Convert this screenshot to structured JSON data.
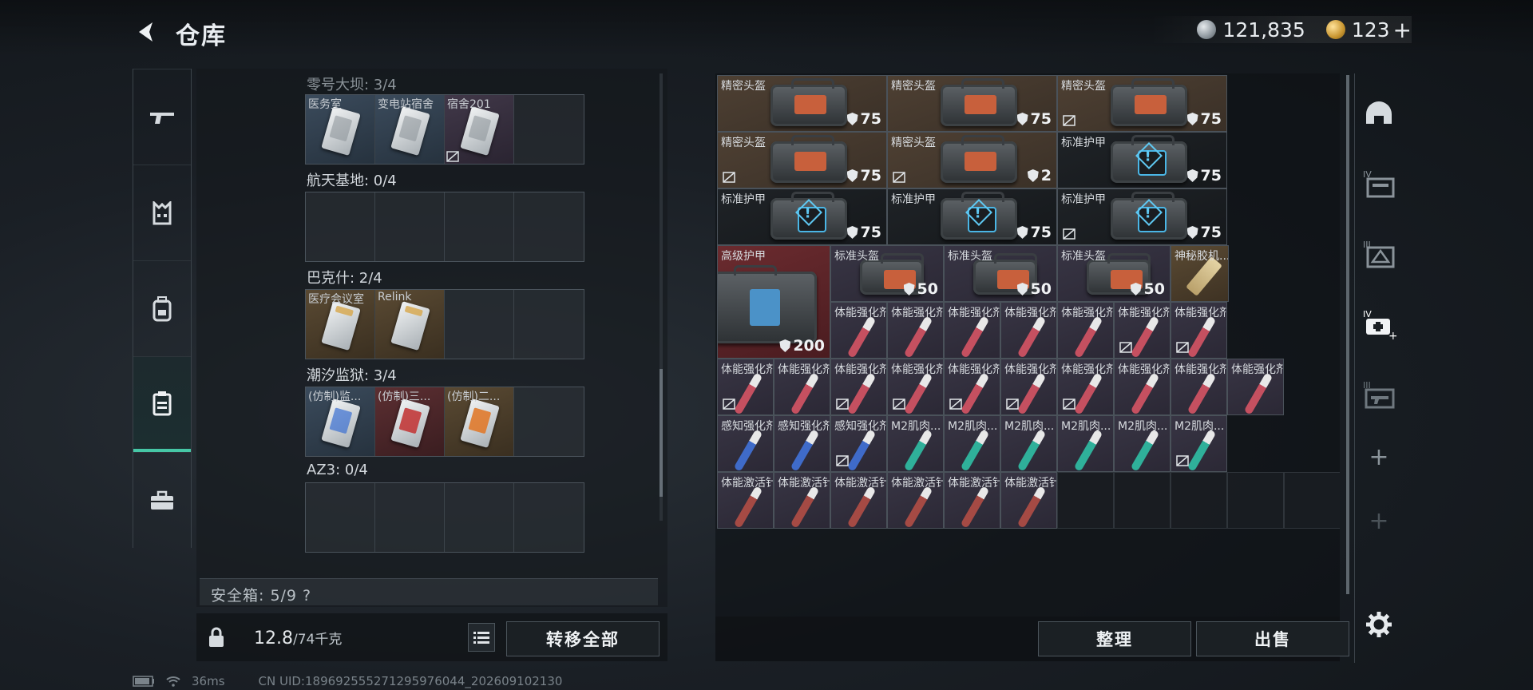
{
  "header": {
    "title": "仓库",
    "silver_amount": "121,835",
    "gold_amount": "123",
    "add_label": "+"
  },
  "left_panel": {
    "groups": [
      {
        "title": "零号大坝: 3/4",
        "slots": [
          {
            "label": "医务室",
            "color": "blue",
            "card": "plain",
            "locked": false
          },
          {
            "label": "变电站宿舍",
            "color": "blue",
            "card": "plain",
            "locked": false
          },
          {
            "label": "宿舍201",
            "color": "purple",
            "card": "plain",
            "locked": true
          },
          {
            "label": "",
            "color": "empty"
          }
        ]
      },
      {
        "title": "航天基地: 0/4",
        "slots": [
          {
            "label": "",
            "color": "empty"
          },
          {
            "label": "",
            "color": "empty"
          },
          {
            "label": "",
            "color": "empty"
          },
          {
            "label": "",
            "color": "empty"
          }
        ]
      },
      {
        "title": "巴克什: 2/4",
        "slots": [
          {
            "label": "医疗会议室",
            "color": "gold",
            "card": "gold",
            "locked": false
          },
          {
            "label": "Relink",
            "color": "gold",
            "card": "gold",
            "locked": false
          },
          {
            "label": "",
            "color": "empty"
          },
          {
            "label": "",
            "color": "empty"
          }
        ]
      },
      {
        "title": "潮汐监狱: 3/4",
        "slots": [
          {
            "label": "(仿制)监...",
            "color": "blue",
            "card": "blue",
            "locked": false
          },
          {
            "label": "(仿制)三...",
            "color": "red",
            "card": "red",
            "locked": false
          },
          {
            "label": "(仿制)二...",
            "color": "gold",
            "card": "orange",
            "locked": false
          },
          {
            "label": "",
            "color": "empty"
          }
        ]
      },
      {
        "title": "AZ3: 0/4",
        "slots": [
          {
            "label": "",
            "color": "empty"
          },
          {
            "label": "",
            "color": "empty"
          },
          {
            "label": "",
            "color": "empty"
          },
          {
            "label": "",
            "color": "empty"
          }
        ]
      }
    ],
    "safebox": "安全箱: 5/9 ?",
    "weight_current": "12.8",
    "weight_max": "/74千克",
    "transfer_all": "转移全部"
  },
  "stash": {
    "rows": [
      [
        {
          "label": "精密头盔",
          "type": "bag",
          "color": "brown",
          "dur": "75",
          "w": 3,
          "locked": false
        },
        {
          "label": "精密头盔",
          "type": "bag",
          "color": "brown",
          "dur": "75",
          "w": 3,
          "locked": false
        },
        {
          "label": "精密头盔",
          "type": "bag",
          "color": "brown",
          "dur": "75",
          "w": 3,
          "locked": true
        }
      ],
      [
        {
          "label": "精密头盔",
          "type": "bag",
          "color": "brown",
          "dur": "75",
          "w": 3,
          "locked": true
        },
        {
          "label": "精密头盔",
          "type": "bag",
          "color": "brown",
          "dur": "2",
          "w": 3,
          "locked": true
        },
        {
          "label": "标准护甲",
          "type": "warn",
          "color": "dark",
          "dur": "75",
          "w": 3,
          "locked": false
        }
      ],
      [
        {
          "label": "标准护甲",
          "type": "warn",
          "color": "dark",
          "dur": "75",
          "w": 3,
          "locked": false
        },
        {
          "label": "标准护甲",
          "type": "warn",
          "color": "dark",
          "dur": "75",
          "w": 3,
          "locked": false
        },
        {
          "label": "标准护甲",
          "type": "warn",
          "color": "dark",
          "dur": "75",
          "w": 3,
          "locked": true
        }
      ]
    ],
    "armor_row": {
      "big": {
        "label": "高级护甲",
        "dur": "200"
      },
      "helmets": [
        {
          "label": "标准头盔",
          "dur": "50"
        },
        {
          "label": "标准头盔",
          "dur": "50"
        },
        {
          "label": "标准头盔",
          "dur": "50"
        }
      ],
      "tape": {
        "label": "神秘胶机..."
      }
    },
    "syringe_rows": [
      [
        {
          "label": "体能强化剂",
          "c": "red",
          "locked": false
        },
        {
          "label": "体能强化剂",
          "c": "red",
          "locked": false
        },
        {
          "label": "体能强化剂",
          "c": "red",
          "locked": false
        },
        {
          "label": "体能强化剂",
          "c": "red",
          "locked": false
        },
        {
          "label": "体能强化剂",
          "c": "red",
          "locked": false
        },
        {
          "label": "体能强化剂",
          "c": "red",
          "locked": true
        },
        {
          "label": "体能强化剂",
          "c": "red",
          "locked": true
        }
      ],
      [
        {
          "label": "体能强化剂",
          "c": "red",
          "locked": true
        },
        {
          "label": "体能强化剂",
          "c": "red",
          "locked": false
        },
        {
          "label": "体能强化剂",
          "c": "red",
          "locked": true
        },
        {
          "label": "体能强化剂",
          "c": "red",
          "locked": true
        },
        {
          "label": "体能强化剂",
          "c": "red",
          "locked": true
        },
        {
          "label": "体能强化剂",
          "c": "red",
          "locked": true
        },
        {
          "label": "体能强化剂",
          "c": "red",
          "locked": true
        },
        {
          "label": "体能强化剂",
          "c": "red",
          "locked": false
        },
        {
          "label": "体能强化剂",
          "c": "red",
          "locked": false
        },
        {
          "label": "体能强化剂",
          "c": "red",
          "locked": false
        }
      ],
      [
        {
          "label": "感知强化剂",
          "c": "blue",
          "locked": false
        },
        {
          "label": "感知强化剂",
          "c": "blue",
          "locked": false
        },
        {
          "label": "感知强化剂",
          "c": "blue",
          "locked": true
        },
        {
          "label": "M2肌肉...",
          "c": "green",
          "locked": false
        },
        {
          "label": "M2肌肉...",
          "c": "green",
          "locked": false
        },
        {
          "label": "M2肌肉...",
          "c": "green",
          "locked": false
        },
        {
          "label": "M2肌肉...",
          "c": "green",
          "locked": false
        },
        {
          "label": "M2肌肉...",
          "c": "green",
          "locked": false
        },
        {
          "label": "M2肌肉...",
          "c": "green",
          "locked": true
        }
      ],
      [
        {
          "label": "体能激活针",
          "c": "brown",
          "locked": false
        },
        {
          "label": "体能激活针",
          "c": "brown",
          "locked": false
        },
        {
          "label": "体能激活针",
          "c": "brown",
          "locked": false
        },
        {
          "label": "体能激活针",
          "c": "brown",
          "locked": false
        },
        {
          "label": "体能激活针",
          "c": "brown",
          "locked": false
        },
        {
          "label": "体能激活针",
          "c": "brown",
          "locked": false
        }
      ]
    ],
    "sort_label": "整理",
    "sell_label": "出售"
  },
  "right_rail": {
    "tier_labels": [
      "IV",
      "III",
      "IV",
      "III"
    ],
    "plus": "+"
  },
  "status": {
    "ping": "36ms",
    "uid": "CN UID:1896925552712959760​44_202609102130"
  }
}
